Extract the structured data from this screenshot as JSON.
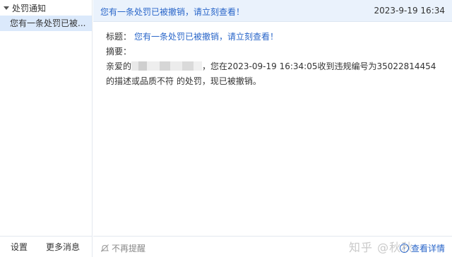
{
  "sidebar": {
    "group_label": "处罚通知",
    "items": [
      {
        "label": "您有一条处罚已被..."
      }
    ],
    "footer": {
      "settings_label": "设置",
      "more_label": "更多消息"
    }
  },
  "header": {
    "title": "您有一条处罚已被撤销，请立刻查看！",
    "time": "2023-9-19 16:34"
  },
  "message": {
    "title_label": "标题：",
    "title_value": "您有一条处罚已被撤销，请立刻查看！",
    "summary_label": "摘要：",
    "greeting_prefix": "亲爱的",
    "body_line1": "，您在2023-09-19 16:34:05收到违规编号为35022814454",
    "body_line2": "的描述或品质不符 的处罚，现已被撤销。"
  },
  "bottom": {
    "mute_label": "不再提醒",
    "details_label": "查看详情",
    "watermark": "知乎 @秋秋"
  },
  "colors": {
    "accent": "#2a66c9",
    "header_bg": "#eaf2fc",
    "selected_bg": "#dbe9fb"
  }
}
